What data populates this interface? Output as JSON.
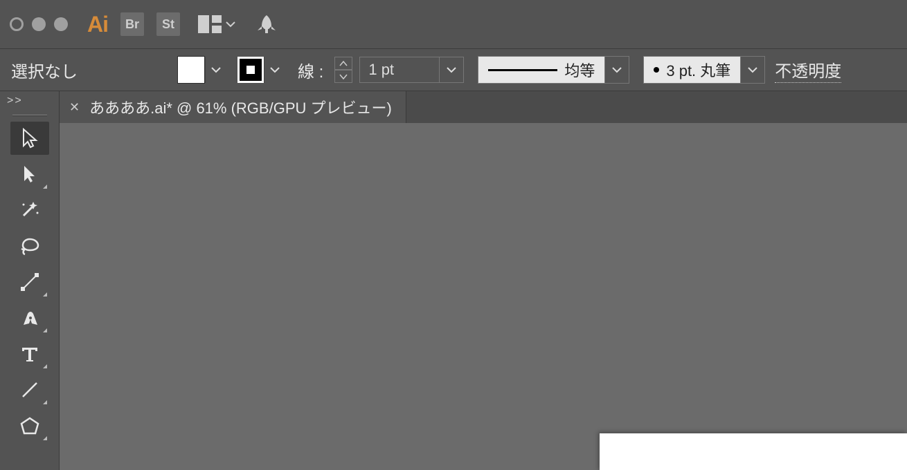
{
  "titlebar": {
    "app_logo_text": "Ai",
    "bridge_btn": "Br",
    "stock_btn": "St"
  },
  "controlbar": {
    "selection_label": "選択なし",
    "stroke_label": "線 :",
    "stroke_weight": "1 pt",
    "profile_label": "均等",
    "brush_label": "3 pt. 丸筆",
    "opacity_label": "不透明度"
  },
  "document": {
    "tab_title": "ああああ.ai* @ 61% (RGB/GPU プレビュー)"
  },
  "panel": {
    "collapse_chevrons": ">>"
  }
}
